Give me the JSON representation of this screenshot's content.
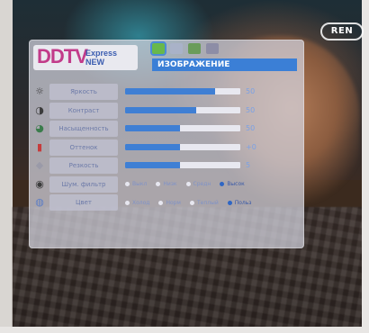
{
  "overlay": {
    "channel_logo": "REN",
    "osd_logo": {
      "big": "DDTV",
      "small": "Express NEW"
    },
    "tabs": [
      {
        "icon": "monitor-icon",
        "color": "#68b84b",
        "selected": true
      },
      {
        "icon": "speaker-icon",
        "color": "#a9b2c8",
        "selected": false
      },
      {
        "icon": "clock-icon",
        "color": "#6a9c5a",
        "selected": false
      },
      {
        "icon": "settings-icon",
        "color": "#8d8da6",
        "selected": false
      }
    ],
    "title": "ИЗОБРАЖЕНИЕ",
    "rows": [
      {
        "icon": "brightness-icon",
        "label": "Яркость",
        "value_text": "50",
        "level": 0.78
      },
      {
        "icon": "contrast-icon",
        "label": "Контраст",
        "value_text": "50",
        "level": 0.62
      },
      {
        "icon": "saturation-icon",
        "label": "Насыщенность",
        "value_text": "50",
        "level": 0.48
      },
      {
        "icon": "hue-icon",
        "label": "Оттенок",
        "value_text": "+0",
        "level": 0.48
      },
      {
        "icon": "sharpness-icon",
        "label": "Резкость",
        "value_text": "5",
        "level": 0.48
      }
    ],
    "option_rows": [
      {
        "icon": "noise-reduction-icon",
        "label": "Шум. фильтр",
        "options": [
          "Выкл",
          "Низк",
          "Средн",
          "Высок"
        ],
        "selected_index": 3
      },
      {
        "icon": "color-temp-icon",
        "label": "Цвет",
        "options": [
          "Холод",
          "Норм",
          "Теплый",
          "Польз"
        ],
        "selected_index": 3
      }
    ],
    "colors": {
      "accent": "#3f7fd4",
      "panel": "#d6d6e0"
    }
  }
}
